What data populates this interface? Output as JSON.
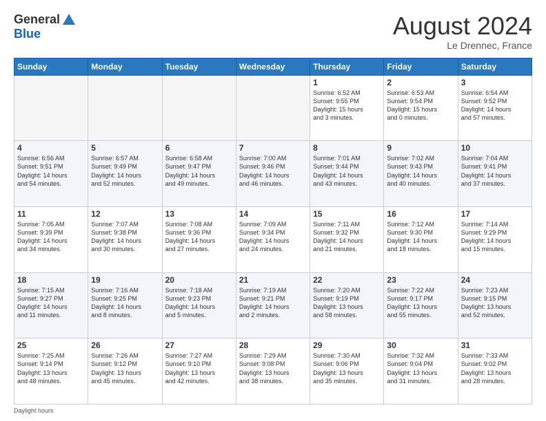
{
  "header": {
    "logo_line1": "General",
    "logo_line2": "Blue",
    "title": "August 2024",
    "subtitle": "Le Drennec, France"
  },
  "footer": {
    "label": "Daylight hours"
  },
  "days_of_week": [
    "Sunday",
    "Monday",
    "Tuesday",
    "Wednesday",
    "Thursday",
    "Friday",
    "Saturday"
  ],
  "weeks": [
    [
      {
        "day": "",
        "info": ""
      },
      {
        "day": "",
        "info": ""
      },
      {
        "day": "",
        "info": ""
      },
      {
        "day": "",
        "info": ""
      },
      {
        "day": "1",
        "info": "Sunrise: 6:52 AM\nSunset: 9:55 PM\nDaylight: 15 hours\nand 3 minutes."
      },
      {
        "day": "2",
        "info": "Sunrise: 6:53 AM\nSunset: 9:54 PM\nDaylight: 15 hours\nand 0 minutes."
      },
      {
        "day": "3",
        "info": "Sunrise: 6:54 AM\nSunset: 9:52 PM\nDaylight: 14 hours\nand 57 minutes."
      }
    ],
    [
      {
        "day": "4",
        "info": "Sunrise: 6:56 AM\nSunset: 9:51 PM\nDaylight: 14 hours\nand 54 minutes."
      },
      {
        "day": "5",
        "info": "Sunrise: 6:57 AM\nSunset: 9:49 PM\nDaylight: 14 hours\nand 52 minutes."
      },
      {
        "day": "6",
        "info": "Sunrise: 6:58 AM\nSunset: 9:47 PM\nDaylight: 14 hours\nand 49 minutes."
      },
      {
        "day": "7",
        "info": "Sunrise: 7:00 AM\nSunset: 9:46 PM\nDaylight: 14 hours\nand 46 minutes."
      },
      {
        "day": "8",
        "info": "Sunrise: 7:01 AM\nSunset: 9:44 PM\nDaylight: 14 hours\nand 43 minutes."
      },
      {
        "day": "9",
        "info": "Sunrise: 7:02 AM\nSunset: 9:43 PM\nDaylight: 14 hours\nand 40 minutes."
      },
      {
        "day": "10",
        "info": "Sunrise: 7:04 AM\nSunset: 9:41 PM\nDaylight: 14 hours\nand 37 minutes."
      }
    ],
    [
      {
        "day": "11",
        "info": "Sunrise: 7:05 AM\nSunset: 9:39 PM\nDaylight: 14 hours\nand 34 minutes."
      },
      {
        "day": "12",
        "info": "Sunrise: 7:07 AM\nSunset: 9:38 PM\nDaylight: 14 hours\nand 30 minutes."
      },
      {
        "day": "13",
        "info": "Sunrise: 7:08 AM\nSunset: 9:36 PM\nDaylight: 14 hours\nand 27 minutes."
      },
      {
        "day": "14",
        "info": "Sunrise: 7:09 AM\nSunset: 9:34 PM\nDaylight: 14 hours\nand 24 minutes."
      },
      {
        "day": "15",
        "info": "Sunrise: 7:11 AM\nSunset: 9:32 PM\nDaylight: 14 hours\nand 21 minutes."
      },
      {
        "day": "16",
        "info": "Sunrise: 7:12 AM\nSunset: 9:30 PM\nDaylight: 14 hours\nand 18 minutes."
      },
      {
        "day": "17",
        "info": "Sunrise: 7:14 AM\nSunset: 9:29 PM\nDaylight: 14 hours\nand 15 minutes."
      }
    ],
    [
      {
        "day": "18",
        "info": "Sunrise: 7:15 AM\nSunset: 9:27 PM\nDaylight: 14 hours\nand 11 minutes."
      },
      {
        "day": "19",
        "info": "Sunrise: 7:16 AM\nSunset: 9:25 PM\nDaylight: 14 hours\nand 8 minutes."
      },
      {
        "day": "20",
        "info": "Sunrise: 7:18 AM\nSunset: 9:23 PM\nDaylight: 14 hours\nand 5 minutes."
      },
      {
        "day": "21",
        "info": "Sunrise: 7:19 AM\nSunset: 9:21 PM\nDaylight: 14 hours\nand 2 minutes."
      },
      {
        "day": "22",
        "info": "Sunrise: 7:20 AM\nSunset: 9:19 PM\nDaylight: 13 hours\nand 58 minutes."
      },
      {
        "day": "23",
        "info": "Sunrise: 7:22 AM\nSunset: 9:17 PM\nDaylight: 13 hours\nand 55 minutes."
      },
      {
        "day": "24",
        "info": "Sunrise: 7:23 AM\nSunset: 9:15 PM\nDaylight: 13 hours\nand 52 minutes."
      }
    ],
    [
      {
        "day": "25",
        "info": "Sunrise: 7:25 AM\nSunset: 9:14 PM\nDaylight: 13 hours\nand 48 minutes."
      },
      {
        "day": "26",
        "info": "Sunrise: 7:26 AM\nSunset: 9:12 PM\nDaylight: 13 hours\nand 45 minutes."
      },
      {
        "day": "27",
        "info": "Sunrise: 7:27 AM\nSunset: 9:10 PM\nDaylight: 13 hours\nand 42 minutes."
      },
      {
        "day": "28",
        "info": "Sunrise: 7:29 AM\nSunset: 9:08 PM\nDaylight: 13 hours\nand 38 minutes."
      },
      {
        "day": "29",
        "info": "Sunrise: 7:30 AM\nSunset: 9:06 PM\nDaylight: 13 hours\nand 35 minutes."
      },
      {
        "day": "30",
        "info": "Sunrise: 7:32 AM\nSunset: 9:04 PM\nDaylight: 13 hours\nand 31 minutes."
      },
      {
        "day": "31",
        "info": "Sunrise: 7:33 AM\nSunset: 9:02 PM\nDaylight: 13 hours\nand 28 minutes."
      }
    ]
  ]
}
